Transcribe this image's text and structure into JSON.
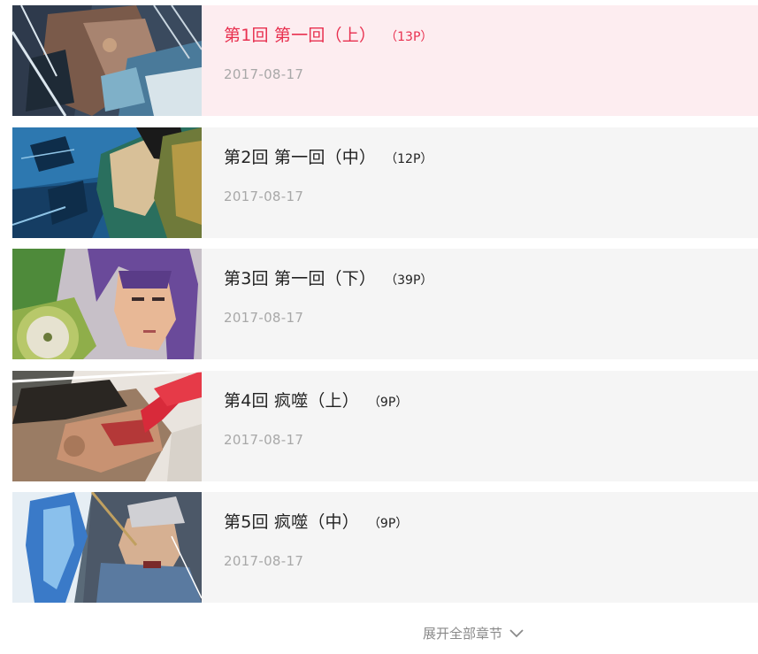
{
  "chapters": [
    {
      "title": "第1回 第一回（上）",
      "pages": "（13P）",
      "date": "2017-08-17",
      "active": true
    },
    {
      "title": "第2回 第一回（中）",
      "pages": "（12P）",
      "date": "2017-08-17",
      "active": false
    },
    {
      "title": "第3回 第一回（下）",
      "pages": "（39P）",
      "date": "2017-08-17",
      "active": false
    },
    {
      "title": "第4回 疯噬（上）",
      "pages": "（9P）",
      "date": "2017-08-17",
      "active": false
    },
    {
      "title": "第5回 疯噬（中）",
      "pages": "（9P）",
      "date": "2017-08-17",
      "active": false
    }
  ],
  "expand_label": "展开全部章节",
  "colors": {
    "active_title": "#e8304f",
    "active_bg": "#fdedf0",
    "item_bg": "#f5f5f5",
    "date": "#a8a8a8"
  },
  "icons": {
    "expand": "chevron-down-icon"
  }
}
